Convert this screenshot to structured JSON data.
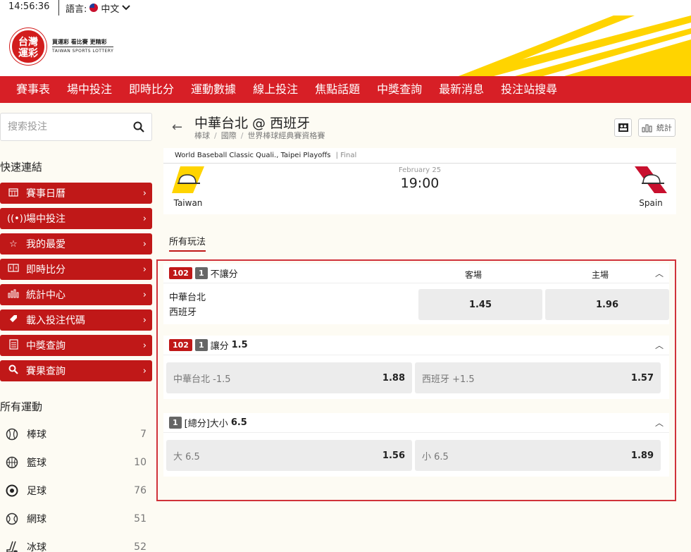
{
  "topbar": {
    "time": "14:56:36",
    "language_label": "語言:",
    "language_value": "中文"
  },
  "logo": {
    "line1": "台灣",
    "line2": "運彩",
    "tagline": "買運彩 看比賽 更精彩",
    "english": "TAIWAN SPORTS LOTTERY"
  },
  "nav": {
    "items": [
      "賽事表",
      "場中投注",
      "即時比分",
      "運動數據",
      "線上投注",
      "焦點話題",
      "中獎查詢",
      "最新消息",
      "投注站搜尋"
    ]
  },
  "sidebar": {
    "search_placeholder": "搜索投注",
    "quick_title": "快速連結",
    "quick_links": [
      {
        "label": "賽事日曆",
        "icon": "calendar-icon"
      },
      {
        "label": "場中投注",
        "icon": "live-icon"
      },
      {
        "label": "我的最愛",
        "icon": "star-icon"
      },
      {
        "label": "即時比分",
        "icon": "scoreboard-icon"
      },
      {
        "label": "統計中心",
        "icon": "stats-icon"
      },
      {
        "label": "載入投注代碼",
        "icon": "tag-icon"
      },
      {
        "label": "中獎查詢",
        "icon": "clipboard-icon"
      },
      {
        "label": "賽果查詢",
        "icon": "search-icon"
      }
    ],
    "sports_title": "所有運動",
    "sports": [
      {
        "label": "棒球",
        "count": "7",
        "icon": "baseball-icon"
      },
      {
        "label": "籃球",
        "count": "10",
        "icon": "basketball-icon"
      },
      {
        "label": "足球",
        "count": "76",
        "icon": "soccer-icon"
      },
      {
        "label": "網球",
        "count": "51",
        "icon": "tennis-icon"
      },
      {
        "label": "冰球",
        "count": "52",
        "icon": "hockey-icon"
      }
    ]
  },
  "match": {
    "title": "中華台北 @ 西班牙",
    "breadcrumb": [
      "棒球",
      "國際",
      "世界棒球經典賽資格賽"
    ],
    "stats_label": "統計",
    "tournament": "World Baseball Classic Quali., Taipei Playoffs",
    "status": "Final",
    "date": "February 25",
    "time": "19:00",
    "away_team": "Taiwan",
    "home_team": "Spain",
    "tab_label": "所有玩法"
  },
  "markets": [
    {
      "code": "102",
      "level": "1",
      "title": "不讓分",
      "line": "",
      "col_away": "客場",
      "col_home": "主場",
      "teams": [
        "中華台北",
        "西班牙"
      ],
      "odds": [
        {
          "label": "",
          "value": "1.45"
        },
        {
          "label": "",
          "value": "1.96"
        }
      ]
    },
    {
      "code": "102",
      "level": "1",
      "title": "讓分",
      "line": "1.5",
      "odds": [
        {
          "label": "中華台北 -1.5",
          "value": "1.88"
        },
        {
          "label": "西班牙 +1.5",
          "value": "1.57"
        }
      ]
    },
    {
      "code": "",
      "level": "1",
      "title": "[總分]大小",
      "line": "6.5",
      "odds": [
        {
          "label": "大 6.5",
          "value": "1.56"
        },
        {
          "label": "小 6.5",
          "value": "1.89"
        }
      ]
    }
  ],
  "colors": {
    "brand_red": "#d71f26",
    "button_red": "#c01818",
    "accent_yellow": "#ffd400"
  }
}
